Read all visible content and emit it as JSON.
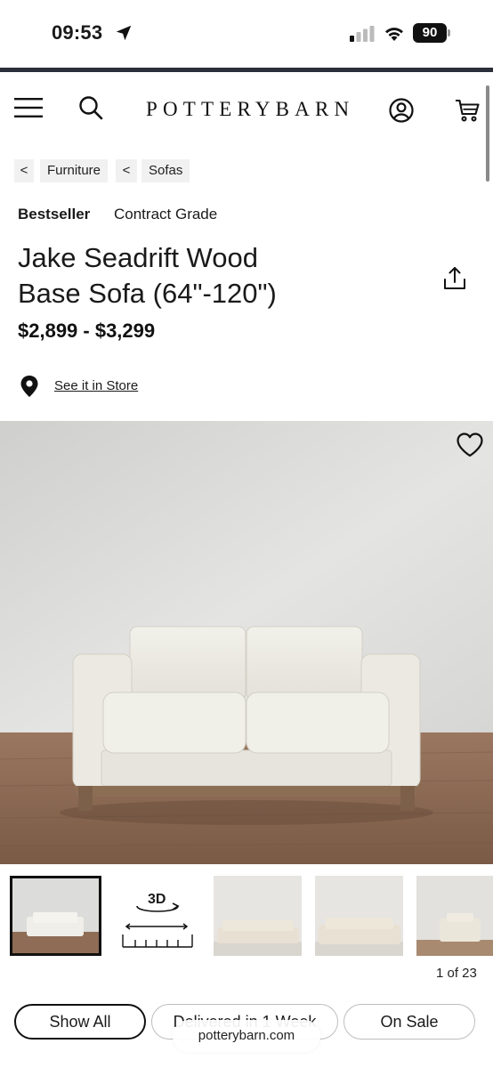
{
  "status_bar": {
    "time": "09:53",
    "battery": "90"
  },
  "header": {
    "logo": "POTTERYBARN"
  },
  "breadcrumb": [
    {
      "chevron": "<",
      "label": "Furniture"
    },
    {
      "chevron": "<",
      "label": "Sofas"
    }
  ],
  "tags": {
    "bestseller": "Bestseller",
    "contract": "Contract Grade"
  },
  "product": {
    "title_line1": "Jake Seadrift Wood",
    "title_line2": "Base Sofa (64\"-120\")",
    "price": "$2,899 - $3,299"
  },
  "store": {
    "link": "See it in Store"
  },
  "gallery": {
    "view_3d_label": "3D",
    "counter": "1 of 23"
  },
  "chips": [
    {
      "label": "Show All"
    },
    {
      "label": "Delivered in 1 Week"
    },
    {
      "label": "On Sale"
    }
  ],
  "browser": {
    "url": "potterybarn.com"
  },
  "colors": {
    "accent": "#111111",
    "nav_rule": "#2b2f3a",
    "chip_bg": "#f1f1f1"
  }
}
